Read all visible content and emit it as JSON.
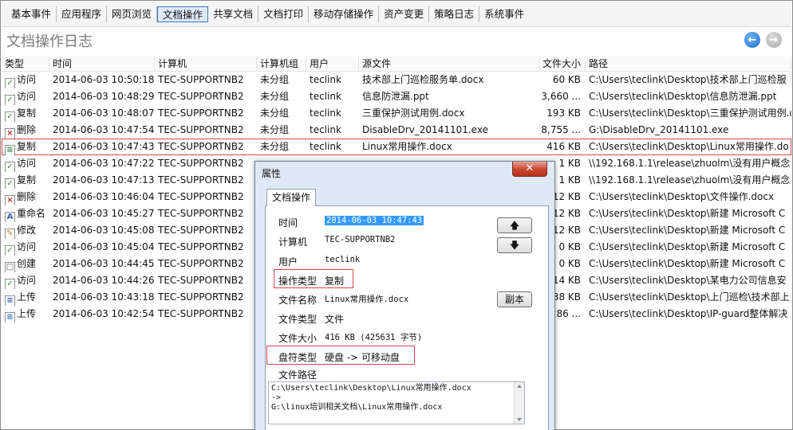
{
  "tabs": [
    "基本事件",
    "应用程序",
    "网页浏览",
    "文档操作",
    "共享文档",
    "文档打印",
    "移动存储操作",
    "资产变更",
    "策略日志",
    "系统事件"
  ],
  "active_tab_index": 3,
  "page_title": "文档操作日志",
  "nav": {
    "back_icon": "arrow-left-icon",
    "forward_icon": "arrow-right-icon",
    "back_glyph": "←",
    "forward_glyph": "→"
  },
  "columns": [
    "类型",
    "时间",
    "计算机",
    "计算机组",
    "用户",
    "源文件",
    "文件大小",
    "路径"
  ],
  "rows": [
    {
      "icon": "visit-icon",
      "glyph": "✓",
      "type": "访问",
      "time": "2014-06-03 10:50:18",
      "computer": "TEC-SUPPORTNB2",
      "group": "未分组",
      "user": "teclink",
      "file": "技术部上门巡检服务单.docx",
      "size": "60 KB",
      "path": "C:\\Users\\teclink\\Desktop\\技术部上门巡检服"
    },
    {
      "icon": "visit-icon",
      "glyph": "✓",
      "type": "访问",
      "time": "2014-06-03 10:48:29",
      "computer": "TEC-SUPPORTNB2",
      "group": "未分组",
      "user": "teclink",
      "file": "信息防泄漏.ppt",
      "size": "3,660 ...",
      "path": "C:\\Users\\teclink\\Desktop\\信息防泄漏.ppt"
    },
    {
      "icon": "copy-icon",
      "glyph": "✓",
      "type": "复制",
      "time": "2014-06-03 10:48:07",
      "computer": "TEC-SUPPORTNB2",
      "group": "未分组",
      "user": "teclink",
      "file": "三重保护测试用例.docx",
      "size": "193 KB",
      "path": "C:\\Users\\teclink\\Desktop\\三重保护测试用例.docx -> C:\\Users\\teclin"
    },
    {
      "icon": "delete-icon",
      "glyph": "×",
      "type": "删除",
      "time": "2014-06-03 10:47:54",
      "computer": "TEC-SUPPORTNB2",
      "group": "未分组",
      "user": "teclink",
      "file": "DisableDrv_20141101.exe",
      "size": "8,755 ...",
      "path": "G:\\DisableDrv_20141101.exe"
    },
    {
      "icon": "copy-icon",
      "glyph": "≡",
      "type": "复制",
      "time": "2014-06-03 10:47:43",
      "computer": "TEC-SUPPORTNB2",
      "group": "未分组",
      "user": "teclink",
      "file": "Linux常用操作.docx",
      "size": "416 KB",
      "path": "C:\\Users\\teclink\\Desktop\\Linux常用操作.do"
    },
    {
      "icon": "visit-icon",
      "glyph": "✓",
      "type": "访问",
      "time": "2014-06-03 10:47:22",
      "computer": "TEC-SUPPORTNB2",
      "group": "",
      "user": "",
      "file": "",
      "size": "1 KB",
      "path": "\\\\192.168.1.1\\release\\zhuolm\\没有用户概念"
    },
    {
      "icon": "copy-icon",
      "glyph": "✓",
      "type": "复制",
      "time": "2014-06-03 10:47:13",
      "computer": "TEC-SUPPORTNB2",
      "group": "",
      "user": "",
      "file": "",
      "size": "1 KB",
      "path": "\\\\192.168.1.1\\release\\zhuolm\\没有用户概念"
    },
    {
      "icon": "delete-icon",
      "glyph": "×",
      "type": "删除",
      "time": "2014-06-03 10:46:04",
      "computer": "TEC-SUPPORTNB2",
      "group": "",
      "user": "",
      "file": "",
      "size": "12 KB",
      "path": "C:\\Users\\teclink\\Desktop\\文件操作.docx"
    },
    {
      "icon": "rename-icon",
      "glyph": "A",
      "type": "重命名",
      "time": "2014-06-03 10:45:27",
      "computer": "TEC-SUPPORTNB2",
      "group": "",
      "user": "",
      "file": "",
      "size": "12 KB",
      "path": "C:\\Users\\teclink\\Desktop\\新建 Microsoft C"
    },
    {
      "icon": "modify-icon",
      "glyph": "✎",
      "type": "修改",
      "time": "2014-06-03 10:45:08",
      "computer": "TEC-SUPPORTNB2",
      "group": "",
      "user": "",
      "file": "",
      "size": "12 KB",
      "path": "C:\\Users\\teclink\\Desktop\\新建 Microsoft C"
    },
    {
      "icon": "visit-icon",
      "glyph": "✓",
      "type": "访问",
      "time": "2014-06-03 10:45:04",
      "computer": "TEC-SUPPORTNB2",
      "group": "",
      "user": "",
      "file": "",
      "size": "0 KB",
      "path": "C:\\Users\\teclink\\Desktop\\新建 Microsoft C"
    },
    {
      "icon": "create-icon",
      "glyph": "□",
      "type": "创建",
      "time": "2014-06-03 10:44:45",
      "computer": "TEC-SUPPORTNB2",
      "group": "",
      "user": "",
      "file": "",
      "size": "0 KB",
      "path": "C:\\Users\\teclink\\Desktop\\新建 Microsoft C"
    },
    {
      "icon": "visit-icon",
      "glyph": "✓",
      "type": "访问",
      "time": "2014-06-03 10:44:26",
      "computer": "TEC-SUPPORTNB2",
      "group": "",
      "user": "",
      "file": "",
      "size": "14 KB",
      "path": "C:\\Users\\teclink\\Desktop\\某电力公司信息安"
    },
    {
      "icon": "upload-icon",
      "glyph": "≡",
      "type": "上传",
      "time": "2014-06-03 10:43:18",
      "computer": "TEC-SUPPORTNB2",
      "group": "",
      "user": "",
      "file": "",
      "size": "38 KB",
      "path": "C:\\Users\\teclink\\Desktop\\上门巡检\\技术部上"
    },
    {
      "icon": "upload-icon",
      "glyph": "≡",
      "type": "上传",
      "time": "2014-06-03 10:42:54",
      "computer": "TEC-SUPPORTNB2",
      "group": "",
      "user": "",
      "file": "",
      "size": "286 ...",
      "path": "C:\\Users\\teclink\\Desktop\\IP-guard整体解决"
    }
  ],
  "selected_row_index": 4,
  "dialog": {
    "title": "属性",
    "close_glyph": "✕",
    "tab": "文档操作",
    "labels": {
      "time": "时间",
      "computer": "计算机",
      "user": "用户",
      "op_type": "操作类型",
      "file_name": "文件名称",
      "file_type": "文件类型",
      "file_size": "文件大小",
      "drive_type": "盘符类型",
      "file_path": "文件路径"
    },
    "values": {
      "time": "2014-06-03 10:47:43",
      "computer": "TEC-SUPPORTNB2",
      "user": "teclink",
      "op_type": "复制",
      "file_name": "Linux常用操作.docx",
      "file_type": "文件",
      "file_size": "416 KB (425631 字节)",
      "drive_type": "硬盘 -> 可移动盘"
    },
    "path_lines": [
      "C:\\Users\\teclink\\Desktop\\Linux常用操作.docx",
      "->",
      "G:\\linux培训相关文档\\Linux常用操作.docx"
    ],
    "up_glyph": "🡅",
    "down_glyph": "🡇",
    "copy_button": "副本",
    "colors": {
      "highlight_box": "#d9434a",
      "selected_text_bg": "#3399ff"
    }
  }
}
